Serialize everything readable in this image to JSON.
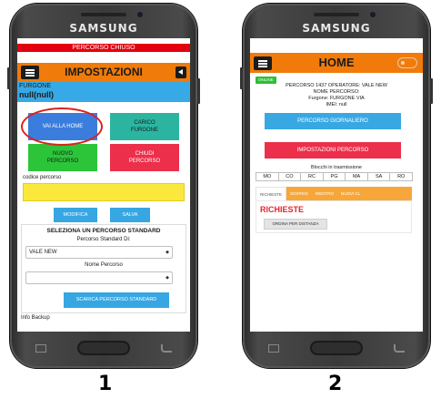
{
  "device_brand": "SAMSUNG",
  "captions": [
    "1",
    "2"
  ],
  "screen1": {
    "banner": "PERCORSO CHIUSO",
    "title": "IMPOSTAZIONI",
    "furgone_label": "FURGONE",
    "furgone_value": "null(null)",
    "tiles": {
      "vai_alla_home": "VAI ALLA HOME",
      "carico_furgone": "CARICO\nFURGONE",
      "nuovo_percorso": "NUOVO\nPERCORSO",
      "chiudi_percorso": "CHIUDI\nPERCORSO"
    },
    "codice_percorso_label": "codice percorso",
    "codice_percorso_value": "",
    "modifica_label": "MODIFICA",
    "salva_label": "SALVA",
    "panel": {
      "title": "SELEZIONA UN PERCORSO STANDARD",
      "standard_label": "Percorso Standard Di:",
      "standard_value": "VALE NEW",
      "nome_label": "Nome Percorso",
      "nome_value": "",
      "scarica_label": "SCARICA PERCORSO STANDARD"
    },
    "info_backup": "Info Backup"
  },
  "screen2": {
    "title": "HOME",
    "status_badge": "ONLINE",
    "info_lines": [
      "PERCORSO 1437 OPERATORE: VALE NEW",
      "NOME PERCORSO:",
      "Furgone: FURGONE VIA",
      "IMEI: null"
    ],
    "percorso_giornaliero_label": "PERCORSO GIORNALIERO",
    "impostazioni_percorso_label": "IMPOSTAZIONI PERCORSO",
    "blocchi_label": "Blocchi in trasmissione",
    "days": [
      "MO",
      "CO",
      "RC",
      "PG",
      "MA",
      "SA",
      "RO"
    ],
    "tabs": [
      "RICHIESTE",
      "SOSPESI",
      "RIENTRO",
      "NUOVI CL"
    ],
    "section_title": "RICHIESTE",
    "order_button_label": "ORDINA PER DISTANZA"
  },
  "colors": {
    "orange": "#f07b0a",
    "blue": "#38a8e3",
    "red": "#ec2f4b",
    "green": "#2cc53a",
    "yellow": "#fae83c"
  }
}
